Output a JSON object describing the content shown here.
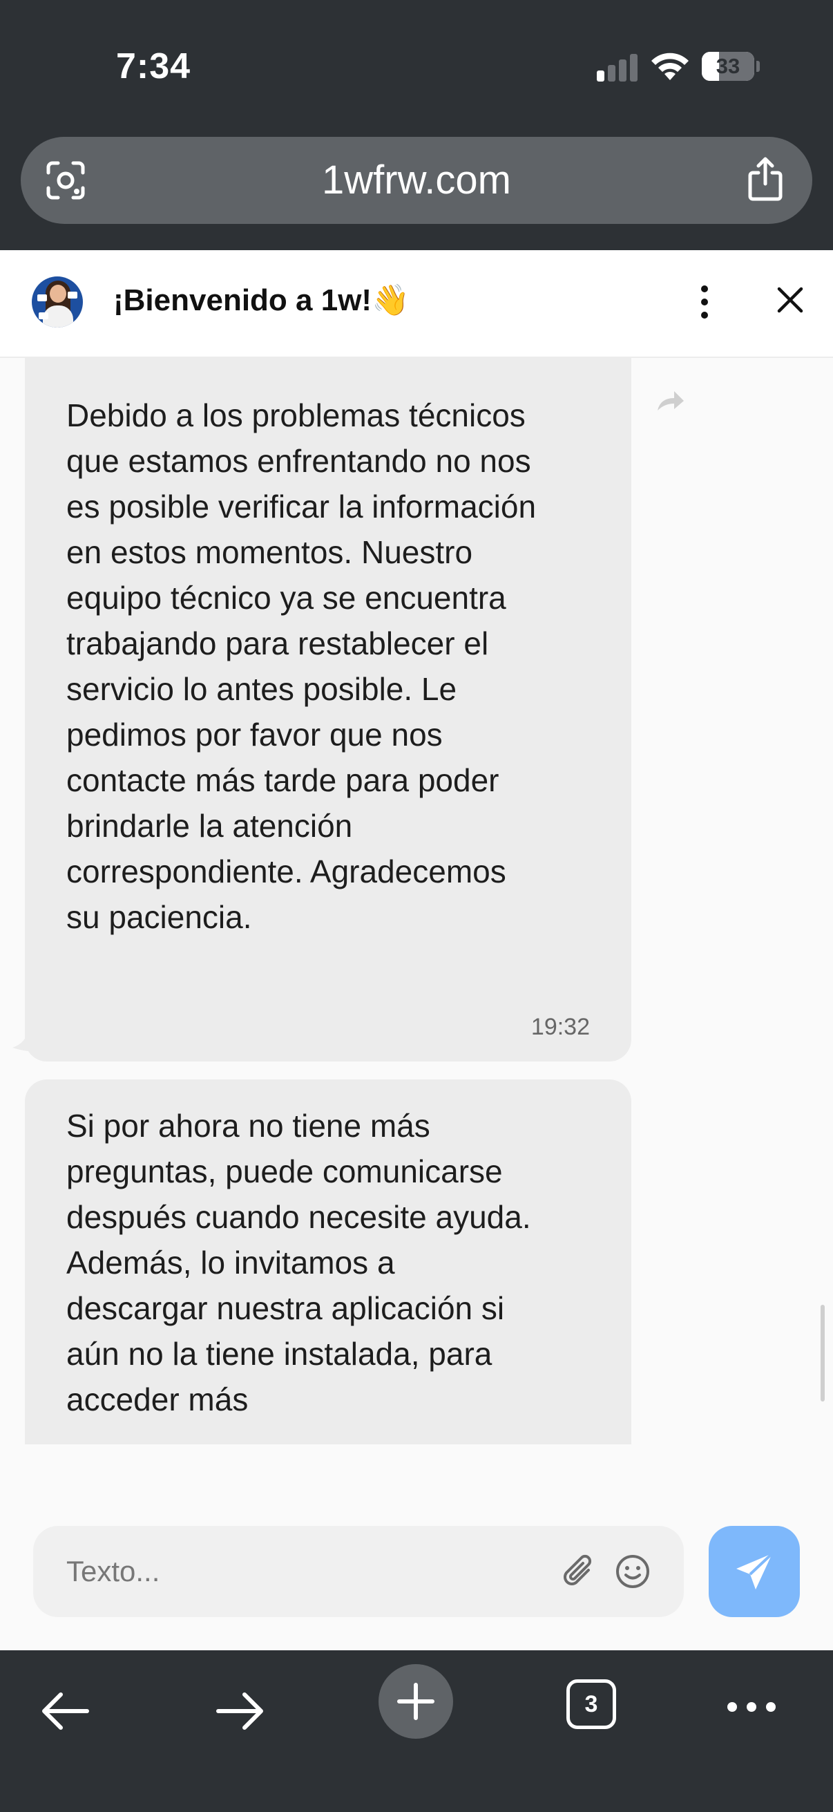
{
  "status_bar": {
    "time": "7:34",
    "battery_level": "33",
    "signal_bars_filled": 1,
    "signal_bars_total": 4
  },
  "browser": {
    "url": "1wfrw.com",
    "open_tabs": "3",
    "icons": [
      "lens-icon",
      "share-icon",
      "back-arrow-icon",
      "forward-arrow-icon",
      "plus-icon",
      "tabs-icon",
      "more-icon"
    ]
  },
  "chat": {
    "title": "¡Bienvenido a 1w!👋",
    "messages": [
      {
        "text": "Debido a los problemas técnicos que estamos enfrentando no nos es posible verificar la información en estos momentos. Nuestro equipo técnico ya se encuentra trabajando para restablecer el servicio lo antes posible. Le pedimos por favor que nos contacte más tarde para poder brindarle la atención correspondiente. Agradecemos su paciencia.",
        "time": "19:32"
      },
      {
        "text": "Si por ahora no tiene más preguntas, puede comunicarse después cuando necesite ayuda. Además, lo invitamos a descargar nuestra aplicación si aún no la tiene instalada, para acceder más"
      }
    ],
    "composer": {
      "placeholder": "Texto..."
    }
  },
  "colors": {
    "chrome_dark": "#2d3135",
    "url_pill": "#5f6367",
    "bubble": "#ececec",
    "send_button": "#7eb8fb"
  }
}
